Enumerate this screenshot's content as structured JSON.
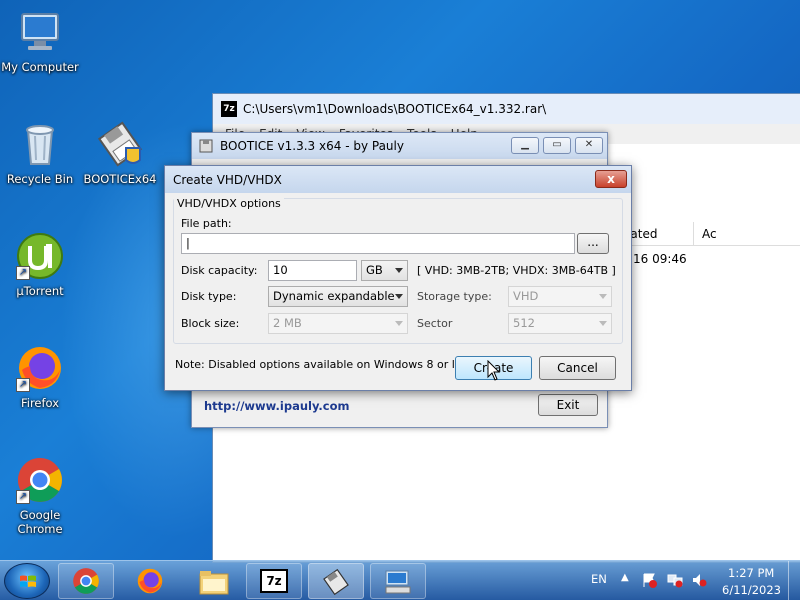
{
  "desktop": {
    "icons": [
      {
        "label": "My Computer"
      },
      {
        "label": "Recycle Bin"
      },
      {
        "label": "BOOTICEx64"
      },
      {
        "label": "µTorrent"
      },
      {
        "label": "Firefox"
      },
      {
        "label": "Google Chrome"
      }
    ]
  },
  "explorer": {
    "title": "C:\\Users\\vm1\\Downloads\\BOOTICEx64_v1.332.rar\\",
    "menu": [
      "File",
      "Edit",
      "View",
      "Favorites",
      "Tools",
      "Help"
    ],
    "col_created": "Created",
    "col_ac": "Ac",
    "cell_time": "16 09:46"
  },
  "bootice": {
    "title": "BOOTICE v1.3.3 x64 - by Pauly",
    "url": "http://www.ipauly.com",
    "exit_label": "Exit"
  },
  "dialog": {
    "title": "Create VHD/VHDX",
    "close_label": "x",
    "group_label": "VHD/VHDX options",
    "file_path_label": "File path:",
    "file_path_value": "|",
    "browse_label": "...",
    "capacity_label": "Disk capacity:",
    "capacity_value": "10",
    "capacity_unit": "GB",
    "capacity_hint": "[ VHD: 3MB-2TB; VHDX: 3MB-64TB ]",
    "disk_type_label": "Disk type:",
    "disk_type_value": "Dynamic expandable",
    "storage_type_label": "Storage type:",
    "storage_type_value": "VHD",
    "block_size_label": "Block size:",
    "block_size_value": "2 MB",
    "sector_label": "Sector",
    "sector_value": "512",
    "note": "Note: Disabled options available on Windows 8 or later.",
    "create_label": "Create",
    "cancel_label": "Cancel"
  },
  "taskbar": {
    "lang": "EN",
    "time": "1:27 PM",
    "date": "6/11/2023"
  }
}
